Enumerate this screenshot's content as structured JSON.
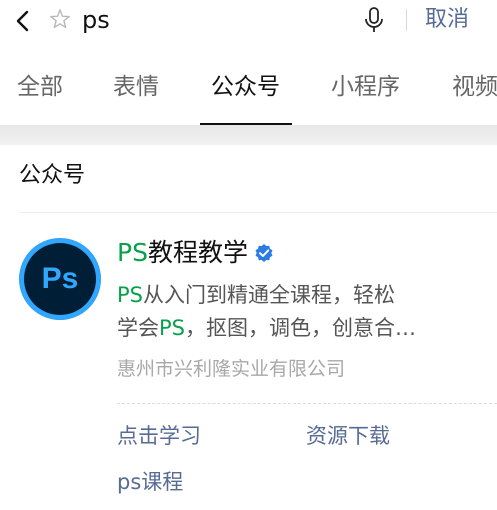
{
  "search": {
    "query": "ps",
    "cancel_label": "取消"
  },
  "tabs": [
    {
      "label": "全部"
    },
    {
      "label": "表情"
    },
    {
      "label": "公众号"
    },
    {
      "label": "小程序"
    },
    {
      "label": "视频"
    }
  ],
  "active_tab": "公众号",
  "section": {
    "title": "公众号"
  },
  "account": {
    "avatar_text": "Ps",
    "name_prefix": "PS",
    "name_rest": "教程教学",
    "verified": true,
    "desc_line1_prefix": "PS",
    "desc_line1_rest": "从入门到精通全课程，轻松",
    "desc_line2_start": "学会",
    "desc_line2_highlight": "PS",
    "desc_line2_end": "，抠图，调色，创意合…",
    "company": "惠州市兴利隆实业有限公司",
    "menu": [
      {
        "label": "点击学习"
      },
      {
        "label": "资源下载"
      },
      {
        "label": "ps课程"
      }
    ]
  },
  "colors": {
    "accent_link": "#576b95",
    "highlight": "#07a14a",
    "ps_blue": "#31a8ff",
    "ps_dark": "#001e36",
    "verified": "#2a7be4"
  }
}
